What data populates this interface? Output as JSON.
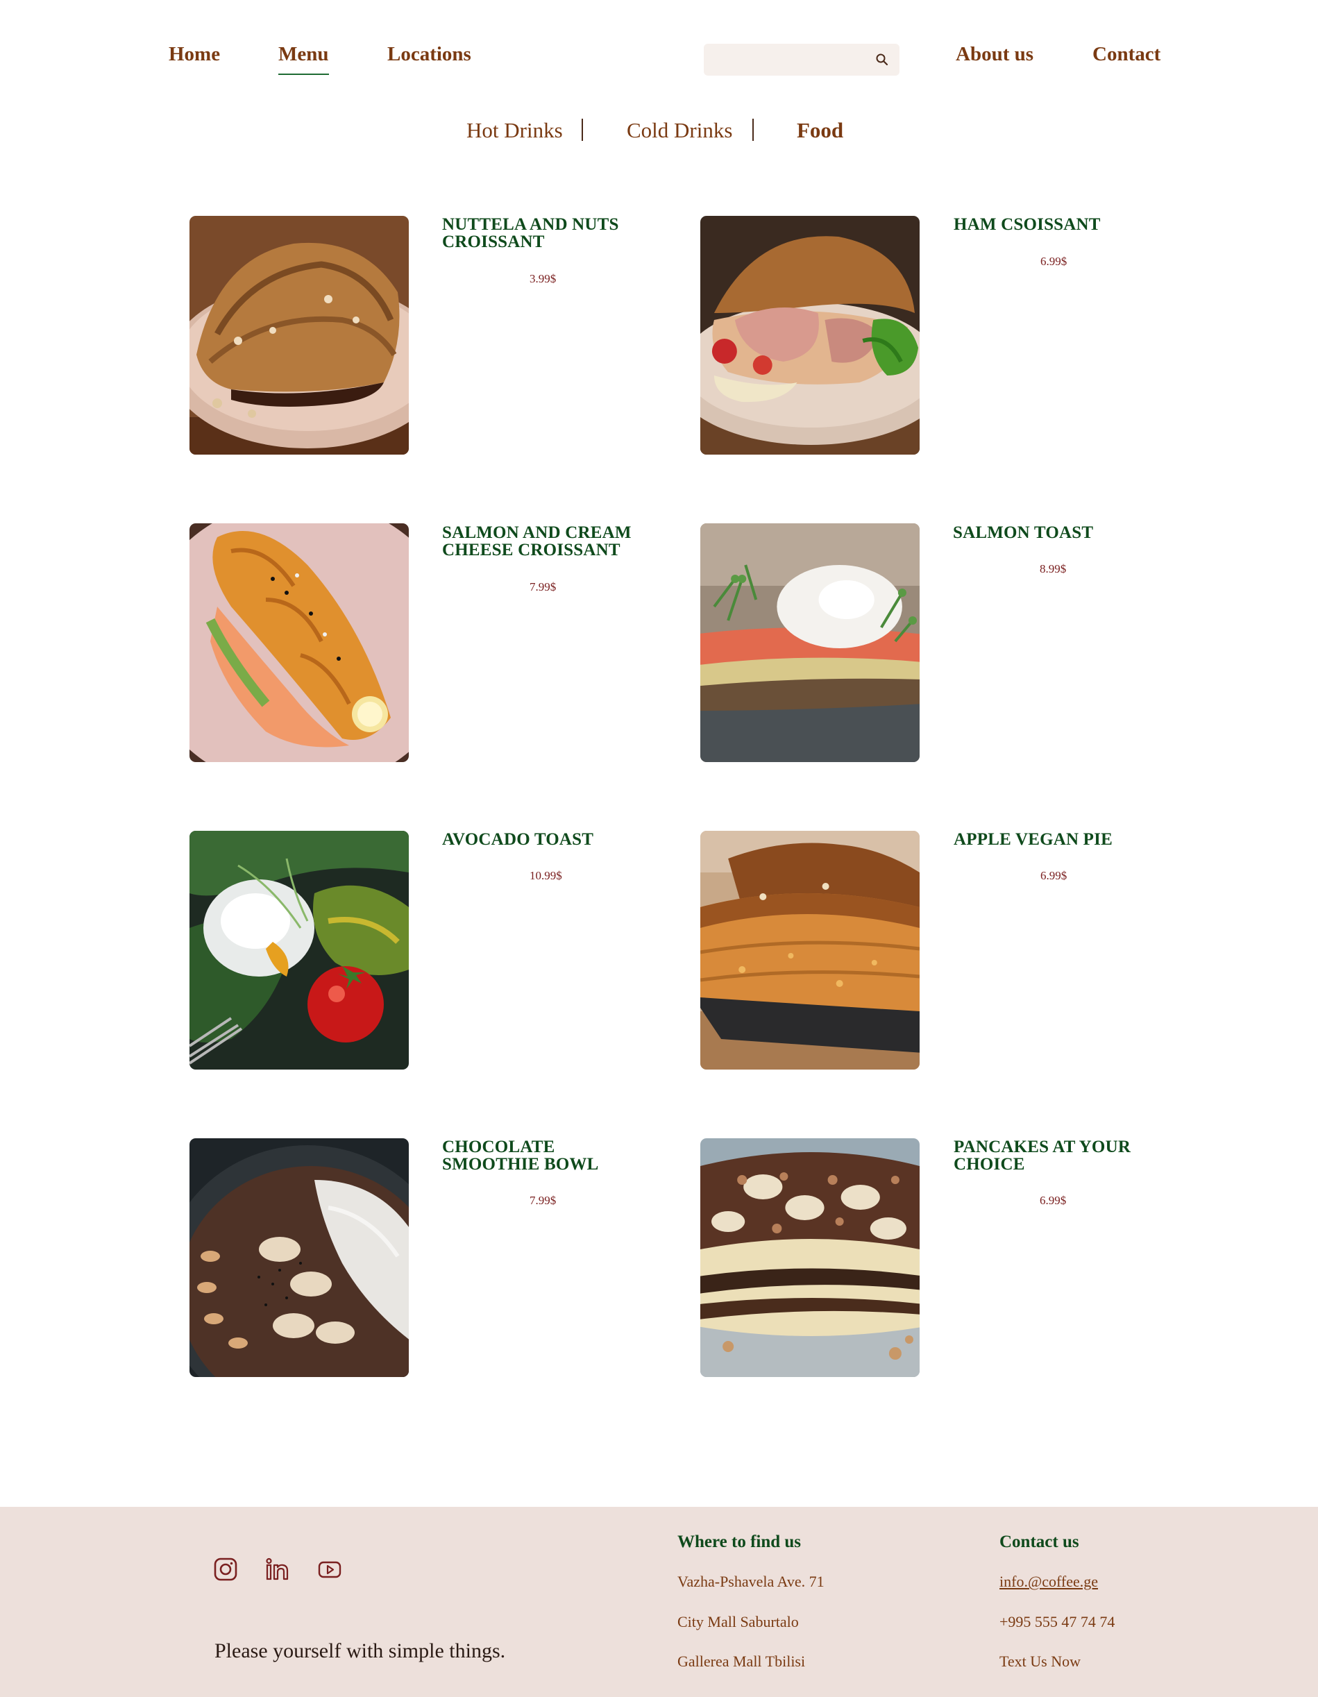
{
  "nav": {
    "home": "Home",
    "menu": "Menu",
    "locations": "Locations",
    "about": "About us",
    "contact": "Contact",
    "search_placeholder": "",
    "search_icon": "search-icon",
    "active": "menu"
  },
  "categories": {
    "hot": "Hot Drinks",
    "cold": "Cold Drinks",
    "food": "Food",
    "active": "food"
  },
  "items": [
    {
      "name": "NUTTELA AND NUTS CROISSANT",
      "price": "3.99$",
      "image": "nutella-croissant-photo"
    },
    {
      "name": "HAM CSOISSANT",
      "price": "6.99$",
      "image": "ham-croissant-photo"
    },
    {
      "name": "SALMON AND CREAM CHEESE CROISSANT",
      "price": "7.99$",
      "image": "salmon-croissant-photo"
    },
    {
      "name": "SALMON TOAST",
      "price": "8.99$",
      "image": "salmon-toast-photo"
    },
    {
      "name": "AVOCADO TOAST",
      "price": "10.99$",
      "image": "avocado-toast-photo"
    },
    {
      "name": "APPLE VEGAN PIE",
      "price": "6.99$",
      "image": "apple-pie-photo"
    },
    {
      "name": "CHOCOLATE SMOOTHIE BOWL",
      "price": "7.99$",
      "image": "smoothie-bowl-photo"
    },
    {
      "name": "PANCAKES AT YOUR CHOICE",
      "price": "6.99$",
      "image": "pancakes-photo"
    }
  ],
  "footer": {
    "social": [
      "instagram-icon",
      "linkedin-icon",
      "youtube-icon"
    ],
    "tagline": "Please yourself with simple things.",
    "find_us": {
      "heading": "Where to find us",
      "lines": [
        "Vazha-Pshavela Ave. 71",
        "City Mall Saburtalo",
        "Gallerea Mall Tbilisi"
      ]
    },
    "contact": {
      "heading": "Contact us",
      "email": "info.@coffee.ge",
      "phone": "+995 555 47 74 74",
      "text_us": "Text Us Now"
    }
  },
  "colors": {
    "nav_brown": "#7a3a12",
    "item_green": "#0f4a1c",
    "price_red": "#7a2020",
    "footer_bg": "#ede0db",
    "search_bg": "#f6f0ec"
  }
}
